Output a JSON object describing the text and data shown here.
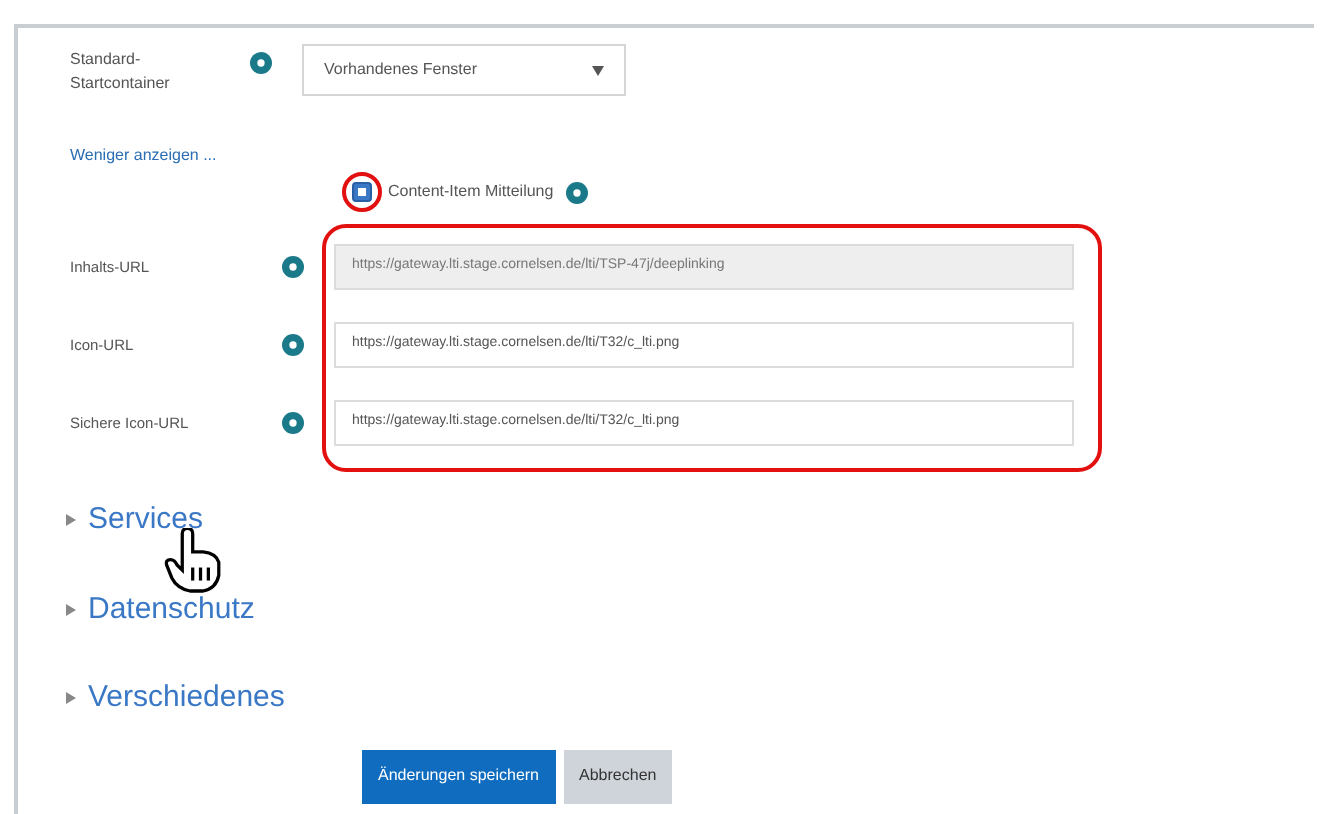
{
  "start_container": {
    "label": "Standard-Startcontainer",
    "value": "Vorhandenes Fenster"
  },
  "toggle_link": "Weniger anzeigen ...",
  "content_item": {
    "label": "Content-Item Mitteilung",
    "checked": true
  },
  "fields": [
    {
      "label": "Inhalts-URL",
      "value": "https://gateway.lti.stage.cornelsen.de/lti/TSP-47j/deeplinking",
      "disabled": true
    },
    {
      "label": "Icon-URL",
      "value": "https://gateway.lti.stage.cornelsen.de/lti/T32/c_lti.png",
      "disabled": false
    },
    {
      "label": "Sichere Icon-URL",
      "value": "https://gateway.lti.stage.cornelsen.de/lti/T32/c_lti.png",
      "disabled": false
    }
  ],
  "sections": [
    {
      "label": "Services",
      "expanded": false
    },
    {
      "label": "Datenschutz",
      "expanded": false
    },
    {
      "label": "Verschiedenes",
      "expanded": false
    }
  ],
  "buttons": [
    {
      "label": "Änderungen speichern",
      "kind": "primary"
    },
    {
      "label": "Abbrechen",
      "kind": "secondary"
    }
  ]
}
